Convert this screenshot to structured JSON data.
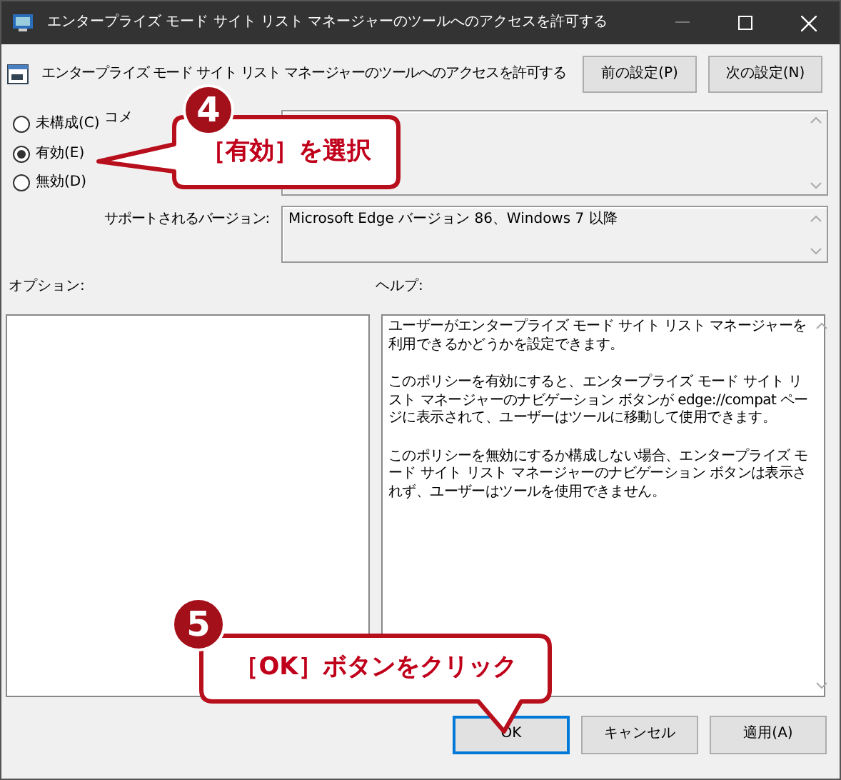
{
  "window": {
    "title": "エンタープライズ モード サイト リスト マネージャーのツールへのアクセスを許可する"
  },
  "header": {
    "title": "エンタープライズ モード サイト リスト マネージャーのツールへのアクセスを許可する",
    "buttons": [
      "前の設定(P)",
      "次の設定(N)"
    ]
  },
  "options": [
    {
      "label": "未構成(C)",
      "selected": false
    },
    {
      "label": "有効(E)",
      "selected": true
    },
    {
      "label": "無効(D)",
      "selected": false
    }
  ],
  "comment": {
    "label": "コメ"
  },
  "supported": {
    "label": "サポートされるバージョン:",
    "value": "Microsoft Edge バージョン 86、Windows 7 以降"
  },
  "options_label": "オプション:",
  "help": {
    "label": "ヘルプ:",
    "paragraphs": [
      "ユーザーがエンタープライズ モード サイト リスト マネージャーを利用できるかどうかを設定できます。",
      "このポリシーを有効にすると、エンタープライズ モード サイト リスト マネージャーのナビゲーション ボタンが edge://compat ページに表示されて、ユーザーはツールに移動して使用できます。",
      "このポリシーを無効にするか構成しない場合、エンタープライズ モード サイト リスト マネージャーのナビゲーション ボタンは表示されず、ユーザーはツールを使用できません。"
    ]
  },
  "buttons": [
    {
      "label": "OK",
      "selected": true
    },
    {
      "label": "キャンセル",
      "selected": false
    },
    {
      "label": "適用(A)",
      "selected": false
    }
  ],
  "callouts": [
    {
      "step": "4",
      "text": "［有効］を選択"
    },
    {
      "step": "5",
      "text": "［OK］ボタンをクリック"
    }
  ]
}
